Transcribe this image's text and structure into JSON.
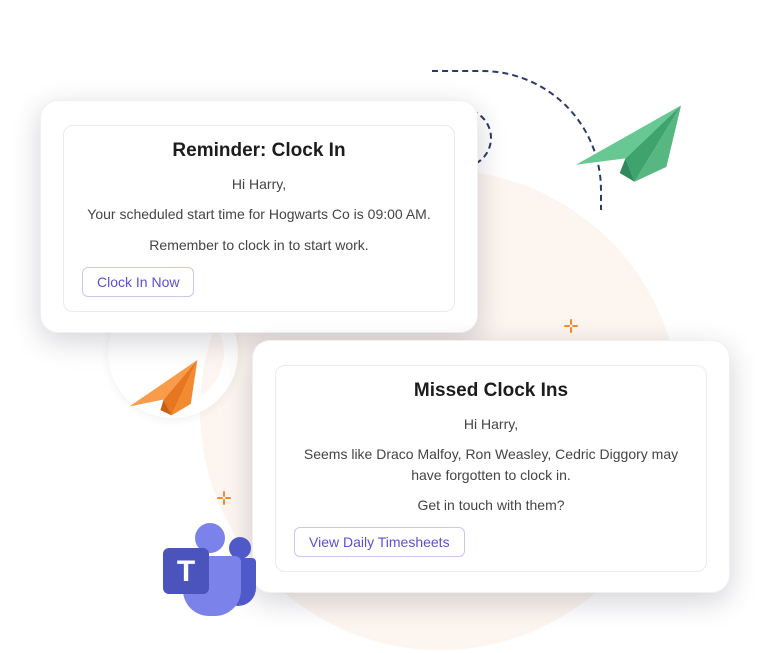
{
  "card_reminder": {
    "title": "Reminder: Clock In",
    "greeting": "Hi Harry,",
    "line1": "Your scheduled start time for Hogwarts Co is 09:00 AM.",
    "line2": "Remember to clock in to start work.",
    "button_label": "Clock In Now"
  },
  "card_missed": {
    "title": "Missed Clock Ins",
    "greeting": "Hi Harry,",
    "line1": "Seems like Draco Malfoy, Ron Weasley, Cedric Diggory may have forgotten to clock in.",
    "line2": "Get in touch with them?",
    "button_label": "View Daily Timesheets"
  },
  "icons": {
    "teams_letter": "T"
  }
}
